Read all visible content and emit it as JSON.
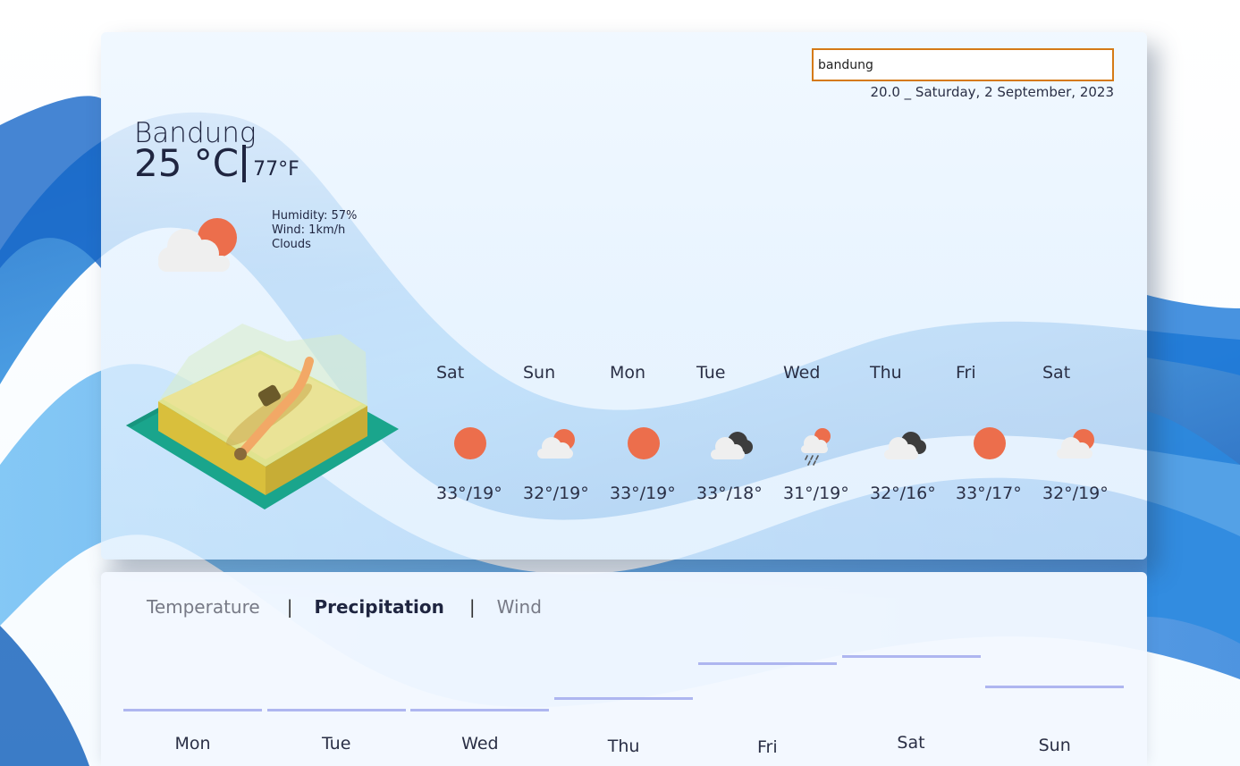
{
  "search": {
    "value": "bandung",
    "placeholder": ""
  },
  "datetime": "20.0 _ Saturday, 2 September, 2023",
  "current": {
    "city": "Bandung",
    "temp_c": "25 °C",
    "temp_f": "77°F",
    "humidity": "Humidity: 57%",
    "wind": "Wind: 1km/h",
    "condition": "Clouds",
    "icon": "partly-cloudy-icon"
  },
  "forecast": [
    {
      "day": "Sat",
      "temp": "33°/19°",
      "icon": "sun-icon"
    },
    {
      "day": "Sun",
      "temp": "32°/19°",
      "icon": "partly-cloudy-icon"
    },
    {
      "day": "Mon",
      "temp": "33°/19°",
      "icon": "sun-icon"
    },
    {
      "day": "Tue",
      "temp": "33°/18°",
      "icon": "broken-clouds-icon"
    },
    {
      "day": "Wed",
      "temp": "31°/19°",
      "icon": "rain-icon"
    },
    {
      "day": "Thu",
      "temp": "32°/16°",
      "icon": "broken-clouds-icon"
    },
    {
      "day": "Fri",
      "temp": "33°/17°",
      "icon": "sun-icon"
    },
    {
      "day": "Sat",
      "temp": "32°/19°",
      "icon": "partly-cloudy-icon"
    }
  ],
  "tabs": {
    "temperature": "Temperature",
    "precipitation": "Precipitation",
    "wind": "Wind",
    "separator": "|",
    "active": "precipitation"
  },
  "chart_data": {
    "type": "bar",
    "categories": [
      "Mon",
      "Tue",
      "Wed",
      "Thu",
      "Fri",
      "Sat",
      "Sun"
    ],
    "values": [
      0.0,
      0.0,
      0.0,
      0.3,
      1.2,
      1.4,
      0.6
    ]
  },
  "colors": {
    "accent": "#ec6e4c",
    "search_border": "#d57a16",
    "bar": "#aeb6f0",
    "text": "#1f2540"
  }
}
